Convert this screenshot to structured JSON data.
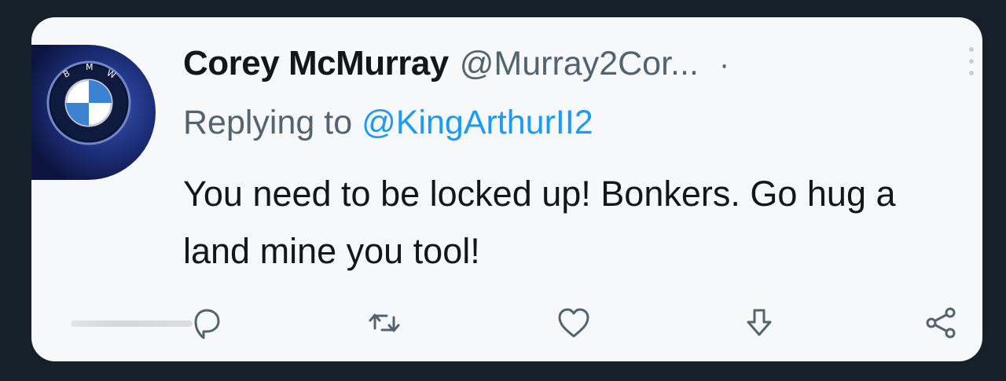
{
  "tweet": {
    "author": {
      "display_name": "Corey McMurray",
      "handle": "@Murray2Cor...",
      "separator": "·",
      "avatar_logo_text": "B M W"
    },
    "reply": {
      "prefix": "Replying to ",
      "mention": "@KingArthurII2"
    },
    "text": "You need to be locked up! Bonkers. Go hug a land mine you tool!",
    "actions": [
      {
        "name": "reply",
        "icon": "speech-bubble-icon"
      },
      {
        "name": "retweet",
        "icon": "retweet-icon"
      },
      {
        "name": "like",
        "icon": "heart-icon"
      },
      {
        "name": "download",
        "icon": "download-arrow-icon"
      },
      {
        "name": "share",
        "icon": "share-nodes-icon"
      }
    ]
  },
  "colors": {
    "background": "#15202b",
    "card": "#f7f8f9",
    "text": "#14171a",
    "secondary_text": "#536471",
    "mention": "#1d9bf0"
  }
}
